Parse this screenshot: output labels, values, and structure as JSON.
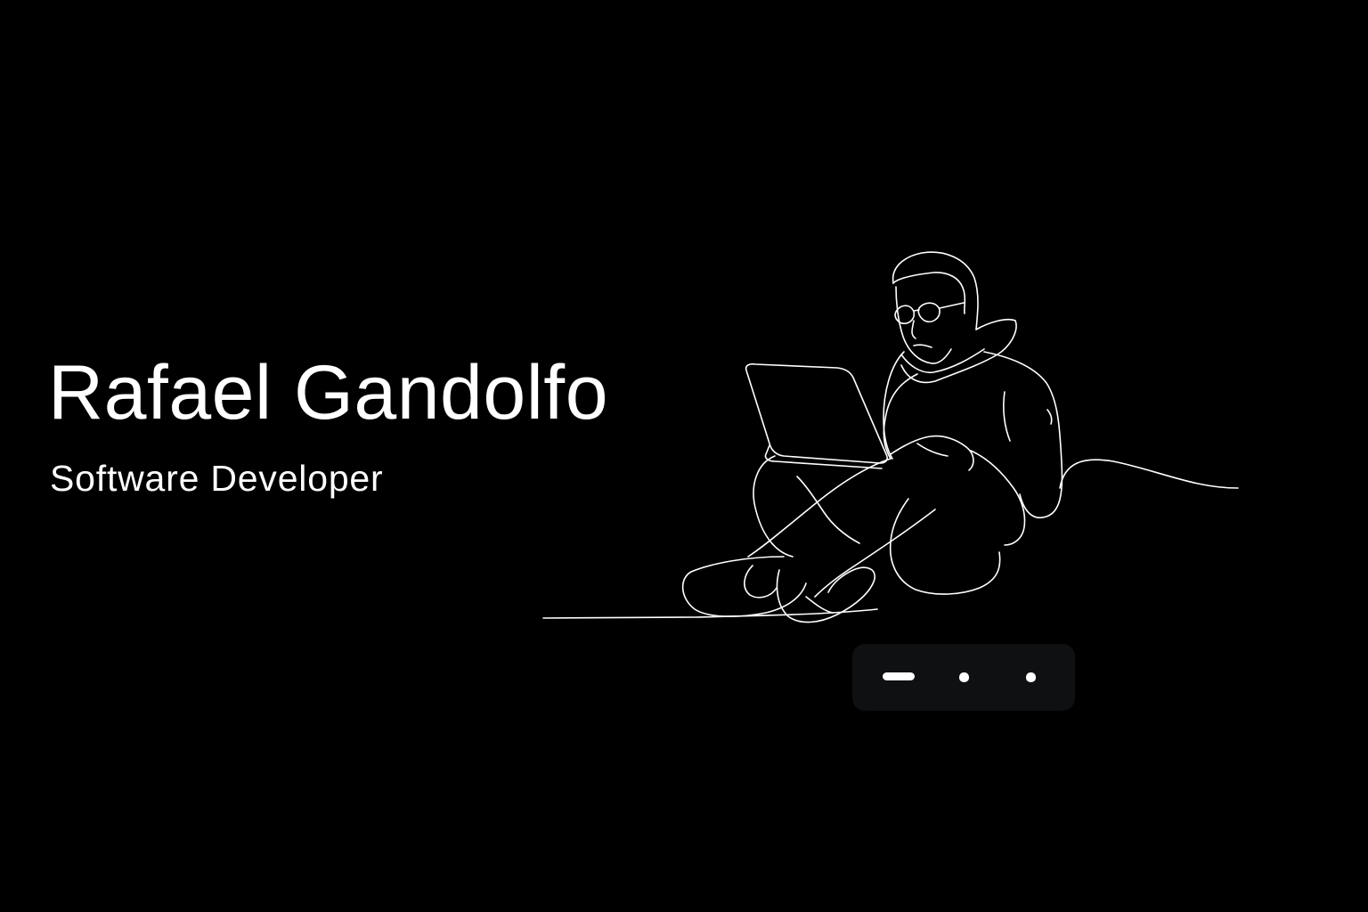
{
  "hero": {
    "name": "Rafael Gandolfo",
    "role": "Software Developer"
  },
  "illustration": {
    "icon": "person-with-laptop-line-art-icon"
  },
  "carousel": {
    "total_slides": 3,
    "active_slide": 1
  },
  "colors": {
    "background": "#000000",
    "text": "#ffffff",
    "pager_background": "#0f1012",
    "line_art": "#ffffff"
  }
}
